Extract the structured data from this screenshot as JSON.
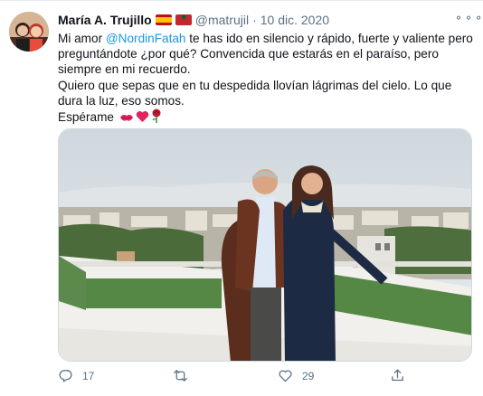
{
  "tweet": {
    "author_name": "María A. Trujillo",
    "handle": "@matrujil",
    "separator": "·",
    "date": "10 dic. 2020",
    "text_lines": {
      "prefix": "Mi amor ",
      "mention": "@NordinFatah",
      "line1_rest": " te has ido en silencio y rápido, fuerte y valiente pero preguntándote ¿por qué? Convencida que estarás en el paraíso, pero siempre en mi recuerdo.",
      "line2": "Quiero que sepas que en tu despedida llovían lágrimas del cielo. Lo que dura la luz, eso somos.",
      "line3": "Espérame"
    },
    "emojis": [
      "💋",
      "❤️",
      "🌹"
    ],
    "more_glyph": "⚬⚬⚬"
  },
  "actions": {
    "reply_count": "17",
    "retweet_count": "",
    "like_count": "29",
    "share_count": ""
  },
  "colors": {
    "link": "#1b95e0",
    "muted": "#5b7083",
    "text": "#0f1419"
  }
}
